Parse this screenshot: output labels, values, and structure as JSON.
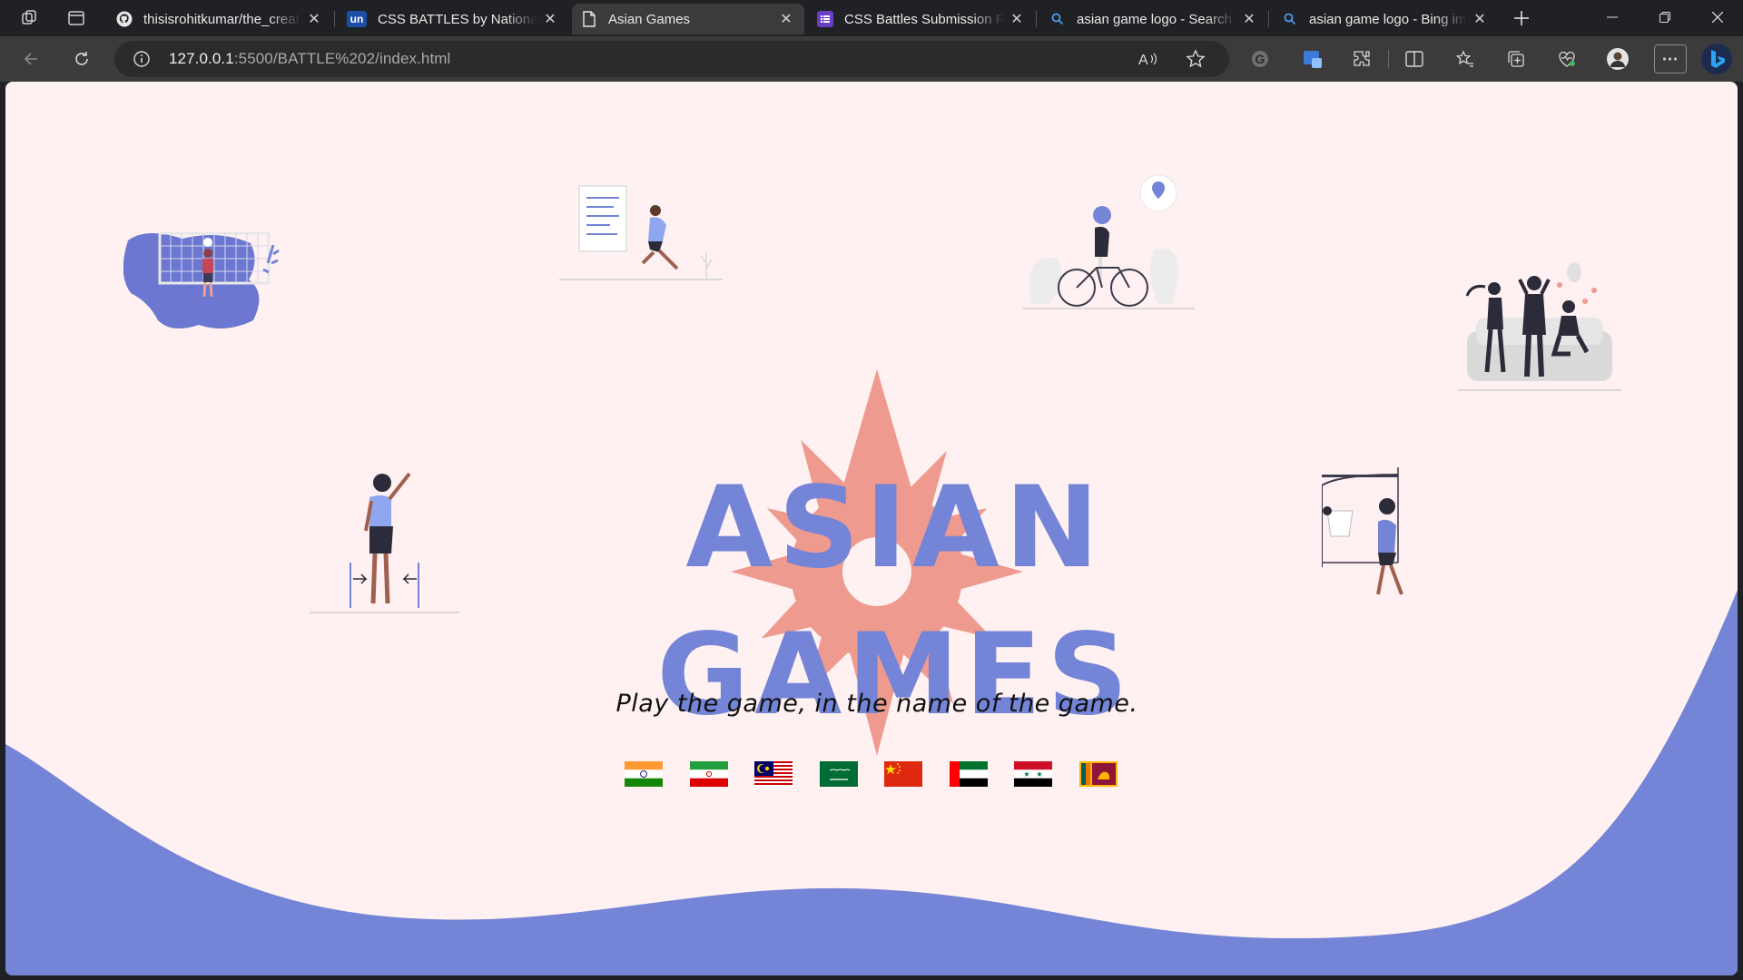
{
  "browser": {
    "tabs": [
      {
        "title": "thisisrohitkumar/the_creat",
        "favicon": "github-icon",
        "active": false
      },
      {
        "title": "CSS BATTLES by National In",
        "favicon": "unstop-icon",
        "favicon_text": "un",
        "active": false
      },
      {
        "title": "Asian Games",
        "favicon": "page-icon",
        "active": true
      },
      {
        "title": "CSS Battles Submission Fo",
        "favicon": "forms-icon",
        "active": false
      },
      {
        "title": "asian game logo - Search",
        "favicon": "search-icon",
        "active": false
      },
      {
        "title": "asian game logo - Bing im",
        "favicon": "search-icon",
        "active": false
      }
    ],
    "address": {
      "host": "127.0.0.1",
      "path": ":5500/BATTLE%202/index.html"
    },
    "more_label": "⋯"
  },
  "page": {
    "title_line1": "ASIAN",
    "title_line2": "GAMES",
    "tagline": "Play the game, in the name of the game.",
    "flags": [
      "india",
      "iran",
      "malaysia",
      "saudi-arabia",
      "china",
      "uae",
      "syria",
      "sri-lanka"
    ],
    "colors": {
      "background": "#fff1f1",
      "accent_blue": "#7484d6",
      "sun_salmon": "#ee9a8f"
    }
  }
}
